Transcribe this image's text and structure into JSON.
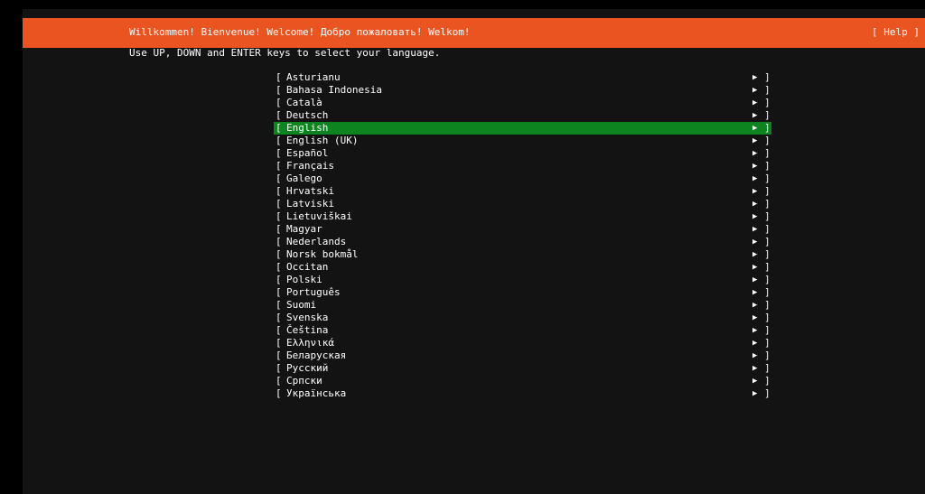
{
  "colors": {
    "header_bg": "#e95420",
    "terminal_bg": "#131313",
    "selected_bg": "#0e8420",
    "text": "#ffffff"
  },
  "header": {
    "title": "Willkommen! Bienvenue! Welcome! Добро пожаловать! Welkom!",
    "help_label": "[ Help ]"
  },
  "instruction": "Use UP, DOWN and ENTER keys to select your language.",
  "list": {
    "open_bracket": "[",
    "close_bracket": "]",
    "arrow": "▶",
    "selected_index": 4,
    "languages": [
      "Asturianu",
      "Bahasa Indonesia",
      "Català",
      "Deutsch",
      "English",
      "English (UK)",
      "Español",
      "Français",
      "Galego",
      "Hrvatski",
      "Latviski",
      "Lietuviškai",
      "Magyar",
      "Nederlands",
      "Norsk bokmål",
      "Occitan",
      "Polski",
      "Português",
      "Suomi",
      "Svenska",
      "Čeština",
      "Ελληνικά",
      "Беларуская",
      "Русский",
      "Српски",
      "Українська"
    ]
  }
}
